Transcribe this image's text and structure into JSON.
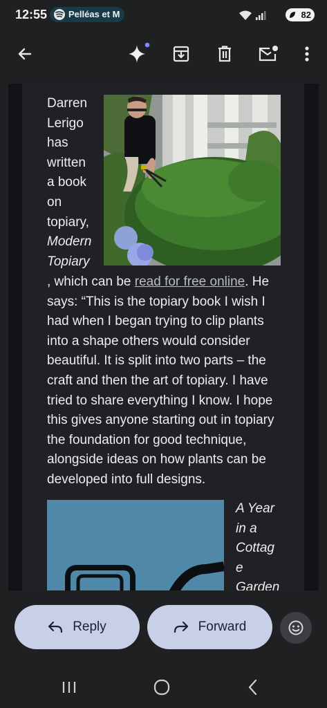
{
  "status_bar": {
    "time": "12:55",
    "spotify_text": "Pelléas et M",
    "battery": "82"
  },
  "email": {
    "para1_lines": [
      "Darren",
      "Lerigo",
      "has",
      "written",
      "a book",
      "on",
      "topiary,"
    ],
    "book_title_line1": "Modern",
    "book_title_line2": "Topiary",
    "line_before_link": ", which can be ",
    "link_text": "read for free online",
    "line_after_link": ". He",
    "body_lines": [
      "says: “This is the topiary book I wish I",
      "had when I began trying to clip plants",
      "into a shape others would consider",
      "beautiful. It is split into two parts – the",
      "craft and then the art of topiary. I have",
      "tried to share everything I know. I hope",
      "this gives anyone starting out in topiary",
      "the foundation for good technique,",
      "alongside ideas on how plants can be",
      "developed into full designs."
    ],
    "book2_title_lines": [
      "A Year",
      "in a",
      "Cottag",
      "e",
      "Garden"
    ]
  },
  "actions": {
    "reply_label": "Reply",
    "forward_label": "Forward"
  },
  "colors": {
    "background": "#1f2022",
    "pill_button": "#c8d0e8",
    "accent_dot": "#7c8cff"
  },
  "icons": {
    "back": "arrow-left-icon",
    "ai": "sparkle-icon",
    "archive": "archive-icon",
    "delete": "trash-icon",
    "mark_unread": "mail-unread-icon",
    "more": "more-vert-icon",
    "reply": "reply-icon",
    "forward": "forward-icon",
    "emoji": "emoji-icon"
  }
}
